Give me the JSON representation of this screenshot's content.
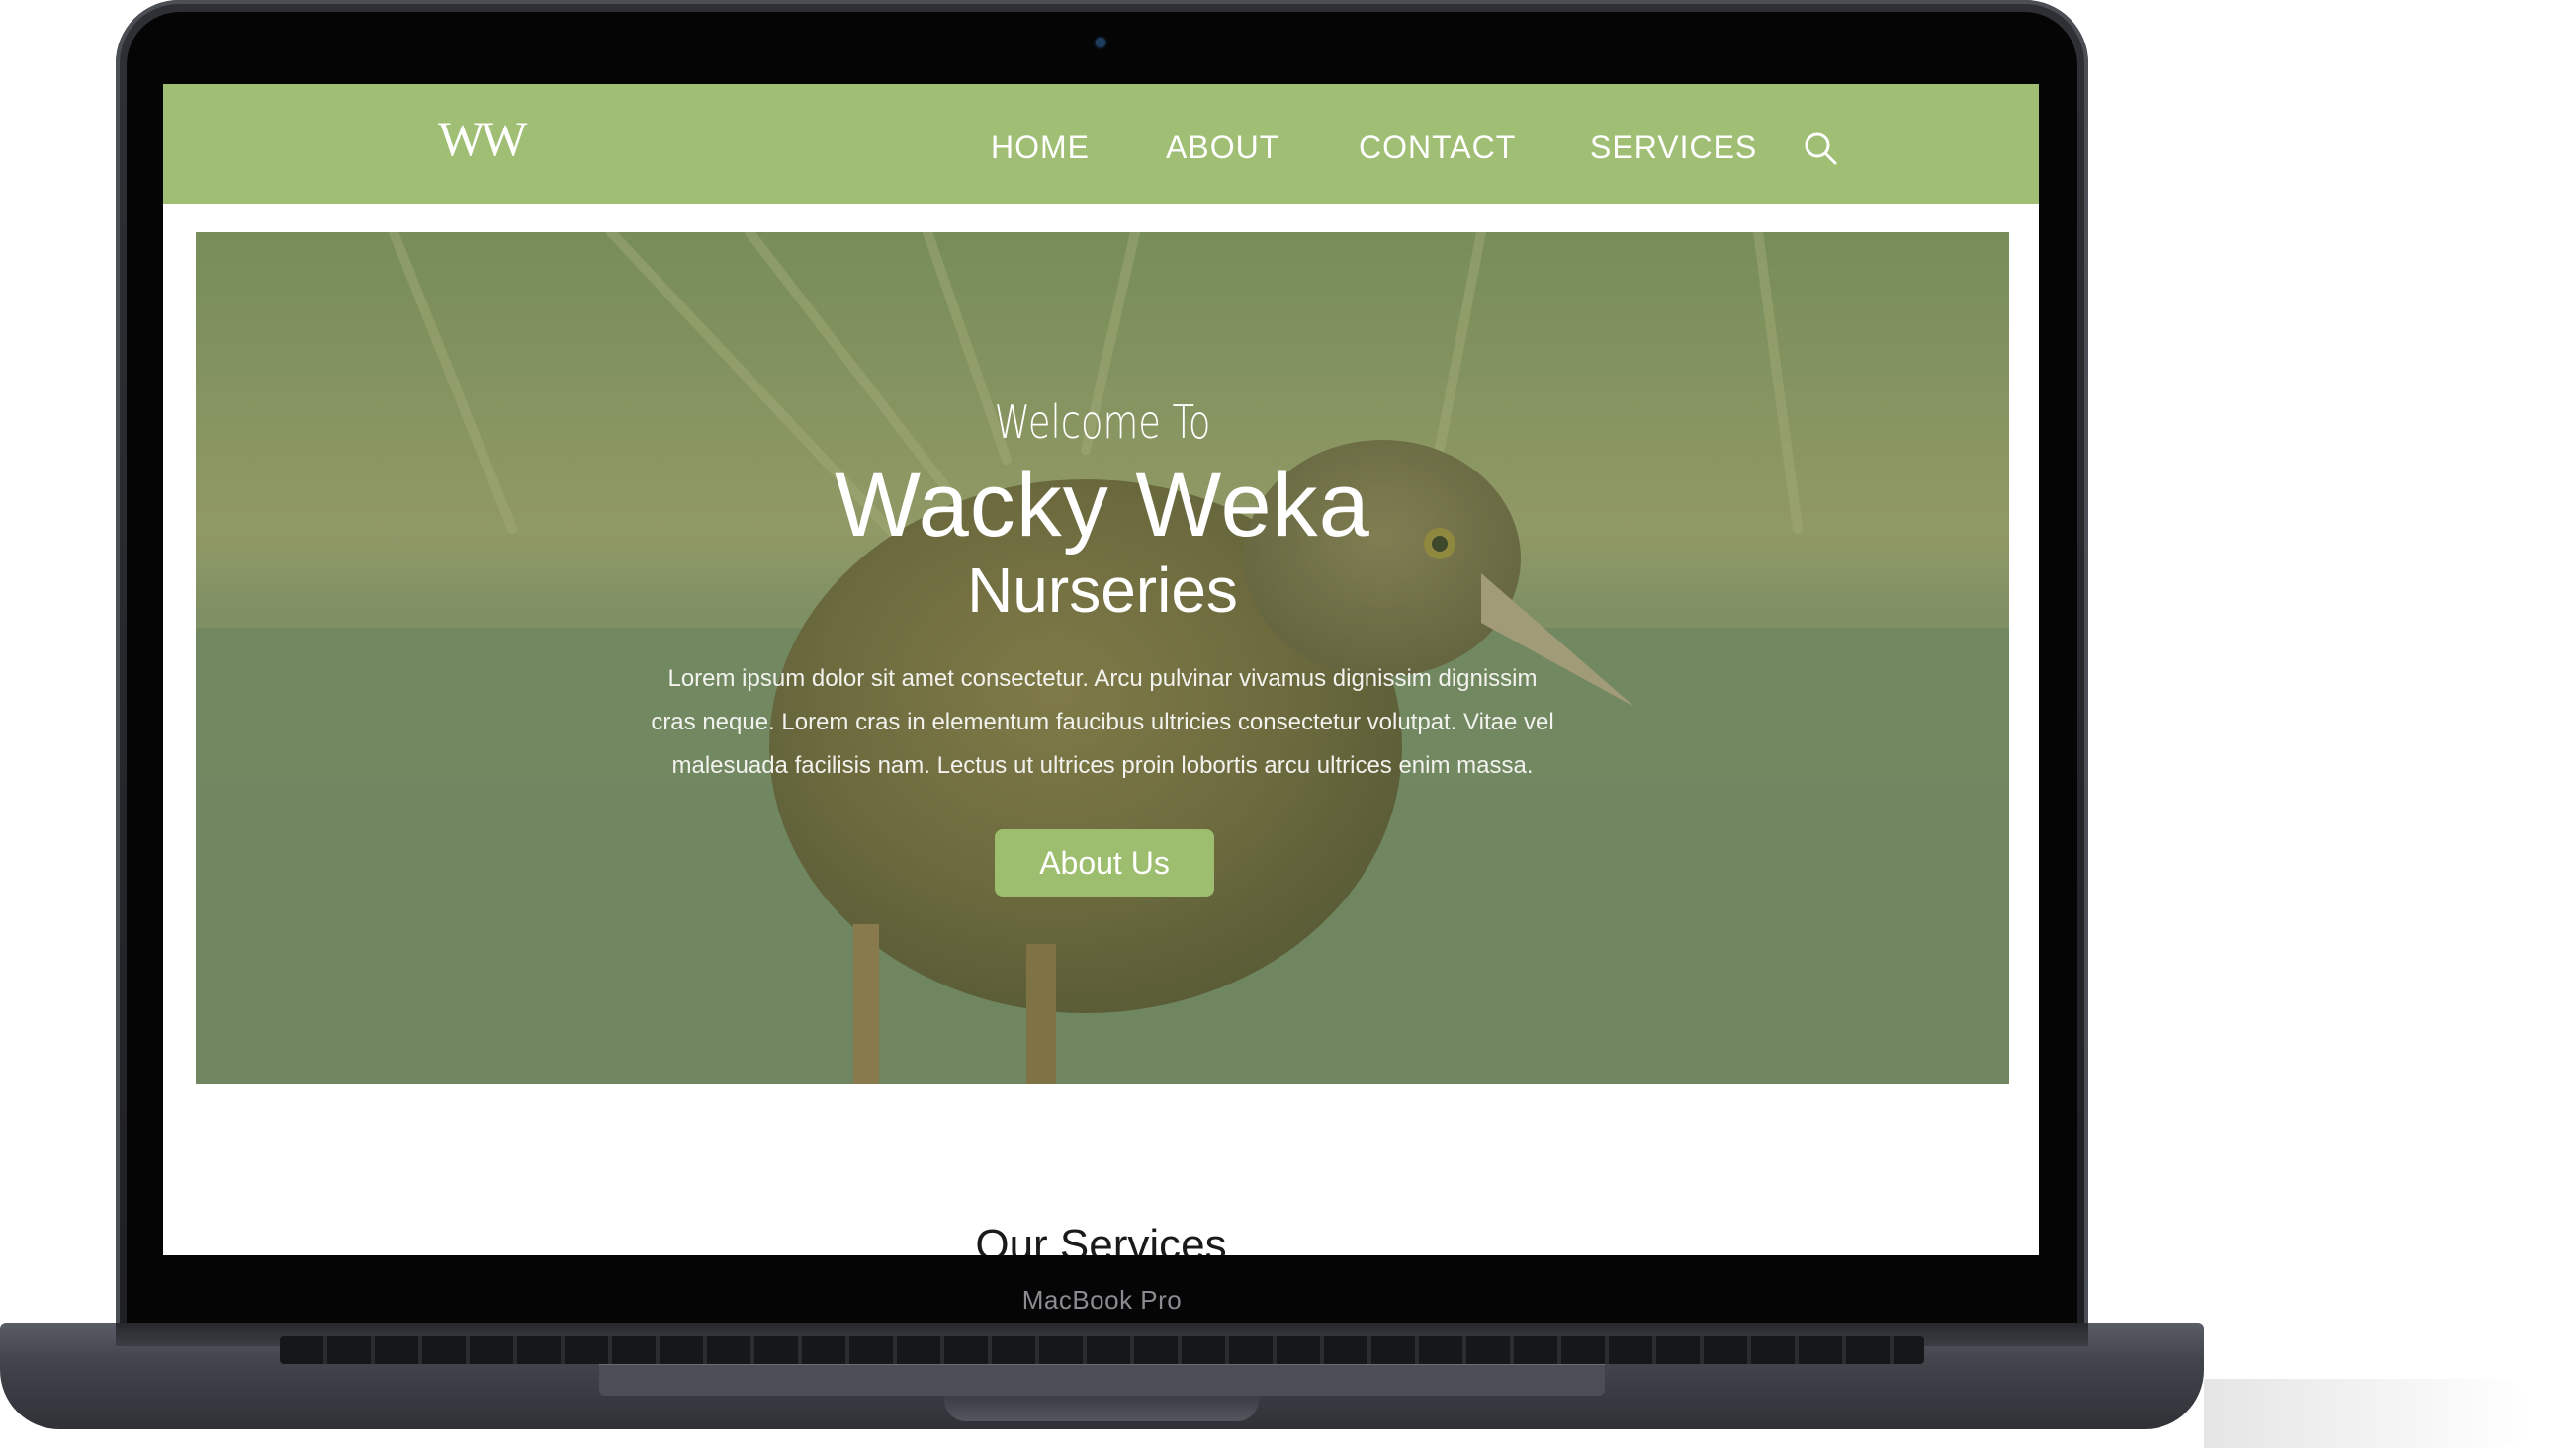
{
  "device": {
    "label": "MacBook Pro"
  },
  "site": {
    "logo": "WW",
    "nav": [
      {
        "label": "HOME"
      },
      {
        "label": "ABOUT"
      },
      {
        "label": "CONTACT"
      },
      {
        "label": "SERVICES"
      }
    ],
    "search_icon": "search-icon"
  },
  "hero": {
    "welcome": "Welcome To",
    "title": "Wacky Weka",
    "subtitle": "Nurseries",
    "body": "Lorem ipsum dolor sit amet consectetur. Arcu pulvinar vivamus dignissim dignissim cras neque. Lorem cras in elementum faucibus ultricies consectetur volutpat. Vitae vel malesuada facilisis nam. Lectus ut ultrices proin lobortis arcu ultrices enim massa.",
    "button": "About Us"
  },
  "services": {
    "title": "Our Services"
  },
  "colors": {
    "nav_green": "#a0bf75",
    "button_green": "#9dbd6f",
    "laptop_gray": "#2e3035"
  }
}
